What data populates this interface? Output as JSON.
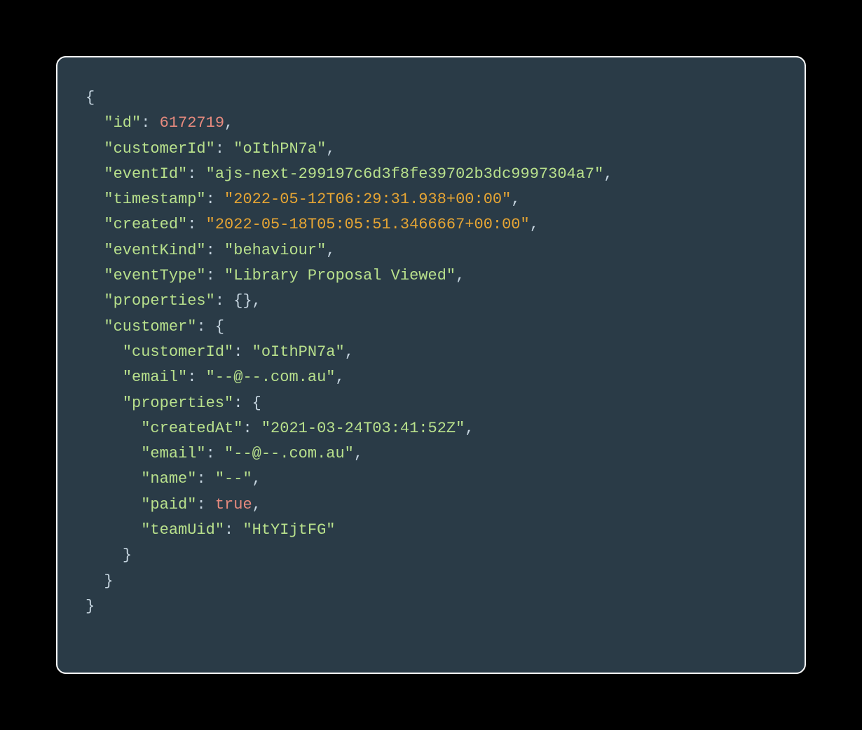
{
  "code": {
    "keys": {
      "id": "\"id\"",
      "customerId": "\"customerId\"",
      "eventId": "\"eventId\"",
      "timestamp": "\"timestamp\"",
      "created": "\"created\"",
      "eventKind": "\"eventKind\"",
      "eventType": "\"eventType\"",
      "properties": "\"properties\"",
      "customer": "\"customer\"",
      "email": "\"email\"",
      "createdAt": "\"createdAt\"",
      "name": "\"name\"",
      "paid": "\"paid\"",
      "teamUid": "\"teamUid\""
    },
    "values": {
      "id": "6172719",
      "customerId": "\"oIthPN7a\"",
      "eventId": "\"ajs-next-299197c6d3f8fe39702b3dc9997304a7\"",
      "timestamp": "\"2022-05-12T06:29:31.938+00:00\"",
      "created": "\"2022-05-18T05:05:51.3466667+00:00\"",
      "eventKind": "\"behaviour\"",
      "eventType": "\"Library Proposal Viewed\"",
      "custCustomerId": "\"oIthPN7a\"",
      "custEmail": "\"--@--.com.au\"",
      "propCreatedAt": "\"2021-03-24T03:41:52Z\"",
      "propEmail": "\"--@--.com.au\"",
      "propName": "\"--\"",
      "propPaid": "true",
      "propTeamUid": "\"HtYIjtFG\""
    },
    "punct": {
      "openBrace": "{",
      "closeBrace": "}",
      "colon": ": ",
      "comma": ",",
      "emptyObj": "{}"
    }
  }
}
